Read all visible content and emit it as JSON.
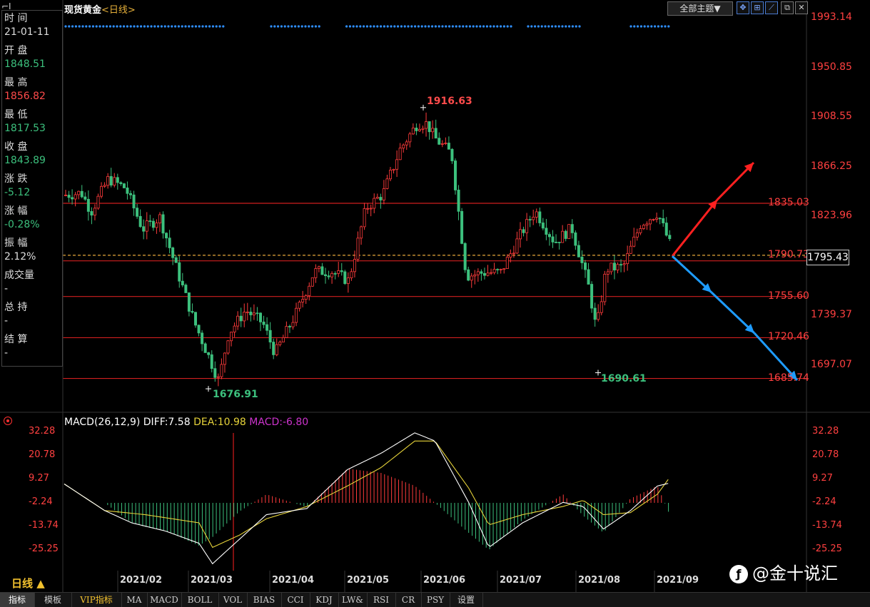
{
  "header": {
    "instrument": "现货黄金",
    "period": "<日线>",
    "theme_label": "全部主题▼",
    "tool_icons": [
      "crosshair-icon",
      "chart-zoom-icon",
      "draw-line-icon",
      "window-icon",
      "close-icon"
    ]
  },
  "info_panel": {
    "rows": [
      {
        "label": "时 间",
        "value": "21-01-11",
        "color": "#dddddd"
      },
      {
        "label": "开 盘",
        "value": "1848.51",
        "color": "#3cc07d"
      },
      {
        "label": "最 高",
        "value": "1856.82",
        "color": "#ff4b4b"
      },
      {
        "label": "最 低",
        "value": "1817.53",
        "color": "#3cc07d"
      },
      {
        "label": "收 盘",
        "value": "1843.89",
        "color": "#3cc07d"
      },
      {
        "label": "涨 跌",
        "value": "-5.12",
        "color": "#3cc07d"
      },
      {
        "label": "涨 幅",
        "value": "-0.28%",
        "color": "#3cc07d"
      },
      {
        "label": "振 幅",
        "value": "2.12%",
        "color": "#dddddd"
      },
      {
        "label": "成交量",
        "value": "-",
        "color": "#dddddd"
      },
      {
        "label": "总 持",
        "value": "-",
        "color": "#dddddd"
      },
      {
        "label": "结 算",
        "value": "-",
        "color": "#dddddd"
      }
    ]
  },
  "chart_data": [
    {
      "type": "candlestick",
      "title": "现货黄金<日线>",
      "y_ticks": [
        "1993.14",
        "1950.85",
        "1908.55",
        "1866.25",
        "1823.96",
        "1739.37",
        "1697.07"
      ],
      "ylim": [
        1680,
        2000
      ],
      "x_ticks": [
        "2021/02",
        "2021/03",
        "2021/04",
        "2021/05",
        "2021/06",
        "2021/07",
        "2021/08",
        "2021/09"
      ],
      "horizontal_levels": [
        "1835.03",
        "1790.73",
        "1755.60",
        "1720.46",
        "1685.74"
      ],
      "current_price": "1795.43",
      "annotations": {
        "high": "1916.63",
        "low_march": "1676.91",
        "low_august": "1690.61"
      },
      "close_path": [
        [
          "2021-01-04",
          1842
        ],
        [
          "2021-01-11",
          1844
        ],
        [
          "2021-01-15",
          1828
        ],
        [
          "2021-01-22",
          1856
        ],
        [
          "2021-01-29",
          1848
        ],
        [
          "2021-02-05",
          1813
        ],
        [
          "2021-02-12",
          1823
        ],
        [
          "2021-02-19",
          1778
        ],
        [
          "2021-02-26",
          1734
        ],
        [
          "2021-03-05",
          1699
        ],
        [
          "2021-03-08",
          1684
        ],
        [
          "2021-03-12",
          1724
        ],
        [
          "2021-03-19",
          1744
        ],
        [
          "2021-03-26",
          1733
        ],
        [
          "2021-03-31",
          1707
        ],
        [
          "2021-04-09",
          1743
        ],
        [
          "2021-04-16",
          1777
        ],
        [
          "2021-04-23",
          1777
        ],
        [
          "2021-04-30",
          1769
        ],
        [
          "2021-05-07",
          1831
        ],
        [
          "2021-05-14",
          1843
        ],
        [
          "2021-05-21",
          1881
        ],
        [
          "2021-05-28",
          1903
        ],
        [
          "2021-06-01",
          1903
        ],
        [
          "2021-06-04",
          1891
        ],
        [
          "2021-06-11",
          1877
        ],
        [
          "2021-06-17",
          1773
        ],
        [
          "2021-06-24",
          1776
        ],
        [
          "2021-07-01",
          1776
        ],
        [
          "2021-07-09",
          1808
        ],
        [
          "2021-07-15",
          1829
        ],
        [
          "2021-07-23",
          1802
        ],
        [
          "2021-07-30",
          1814
        ],
        [
          "2021-08-06",
          1763
        ],
        [
          "2021-08-09",
          1727
        ],
        [
          "2021-08-13",
          1779
        ],
        [
          "2021-08-20",
          1781
        ],
        [
          "2021-08-27",
          1817
        ],
        [
          "2021-09-03",
          1827
        ],
        [
          "2021-09-09",
          1795
        ]
      ],
      "projection_arrows": {
        "up": "red",
        "down": "blue"
      }
    },
    {
      "type": "macd",
      "legend": {
        "name": "MACD(26,12,9)",
        "diff": "DIFF:7.58",
        "dea": "DEA:10.98",
        "macd": "MACD:-6.80"
      },
      "y_ticks": [
        "32.28",
        "20.78",
        "9.27",
        "-2.24",
        "-13.74",
        "-25.25"
      ],
      "ylim": [
        -32,
        33
      ],
      "diff": [
        [
          0,
          7
        ],
        [
          0.06,
          -6
        ],
        [
          0.1,
          -12
        ],
        [
          0.15,
          -16
        ],
        [
          0.2,
          -22
        ],
        [
          0.22,
          -32
        ],
        [
          0.26,
          -20
        ],
        [
          0.3,
          -8
        ],
        [
          0.36,
          -5
        ],
        [
          0.42,
          14
        ],
        [
          0.47,
          22
        ],
        [
          0.52,
          32
        ],
        [
          0.55,
          28
        ],
        [
          0.6,
          -2
        ],
        [
          0.63,
          -24
        ],
        [
          0.68,
          -12
        ],
        [
          0.74,
          -2
        ],
        [
          0.77,
          -4
        ],
        [
          0.8,
          -15
        ],
        [
          0.84,
          -6
        ],
        [
          0.88,
          6
        ],
        [
          0.9,
          7.58
        ]
      ],
      "dea": [
        [
          0,
          7
        ],
        [
          0.06,
          -6
        ],
        [
          0.12,
          -8
        ],
        [
          0.2,
          -12
        ],
        [
          0.22,
          -24
        ],
        [
          0.26,
          -18
        ],
        [
          0.3,
          -10
        ],
        [
          0.36,
          -4
        ],
        [
          0.42,
          6
        ],
        [
          0.47,
          15
        ],
        [
          0.52,
          28
        ],
        [
          0.55,
          28
        ],
        [
          0.6,
          5
        ],
        [
          0.63,
          -13
        ],
        [
          0.68,
          -8
        ],
        [
          0.74,
          -4
        ],
        [
          0.77,
          -1
        ],
        [
          0.8,
          -8
        ],
        [
          0.84,
          -7
        ],
        [
          0.88,
          2
        ],
        [
          0.9,
          10.98
        ]
      ]
    }
  ],
  "watermark": "@金十说汇",
  "period_button": "日线 ▲",
  "bottom_tabs": [
    "指标",
    "模板",
    "VIP指标",
    "MA",
    "MACD",
    "BOLL",
    "VOL",
    "BIAS",
    "CCI",
    "KDJ",
    "LW&",
    "RSI",
    "CR",
    "PSY",
    "设置"
  ],
  "colors": {
    "up": "#ff3b3b",
    "down": "#3cc07d",
    "level_line": "#d01f1f",
    "dea": "#e6d33a",
    "diff": "#ffffff",
    "arrow_up": "#ff2020",
    "arrow_down": "#1e9cff"
  }
}
